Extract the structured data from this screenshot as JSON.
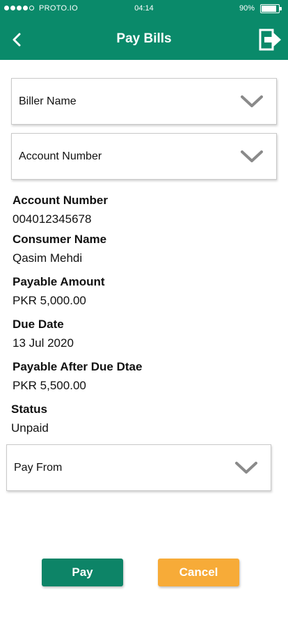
{
  "status_bar": {
    "carrier": "PROTO.IO",
    "time": "04:14",
    "battery_percent": "90%",
    "battery_level": 0.9,
    "signal_bars_filled": 4,
    "signal_bars_total": 5
  },
  "header": {
    "title": "Pay Bills",
    "back_icon": "chevron-left-icon",
    "logout_icon": "logout-icon"
  },
  "dropdowns": {
    "biller_name": {
      "label": "Biller Name",
      "icon": "chevron-down-icon"
    },
    "account_number": {
      "label": "Account Number",
      "icon": "chevron-down-icon"
    },
    "pay_from": {
      "label": "Pay From",
      "icon": "chevron-down-icon"
    }
  },
  "details": {
    "account_number": {
      "label": "Account Number",
      "value": "004012345678"
    },
    "consumer_name": {
      "label": "Consumer Name",
      "value": "Qasim Mehdi"
    },
    "payable_amount": {
      "label": "Payable Amount",
      "value": "PKR 5,000.00"
    },
    "due_date": {
      "label": "Due Date",
      "value": "13 Jul 2020"
    },
    "payable_after_due": {
      "label": "Payable After Due Dtae",
      "value": "PKR 5,500.00"
    },
    "status": {
      "label": "Status",
      "value": "Unpaid"
    }
  },
  "buttons": {
    "pay": "Pay",
    "cancel": "Cancel"
  },
  "colors": {
    "header_bg": "#0a8a6a",
    "pay_button": "#0d8467",
    "cancel_button": "#f7ab38",
    "chevron": "#8a8a8a"
  }
}
